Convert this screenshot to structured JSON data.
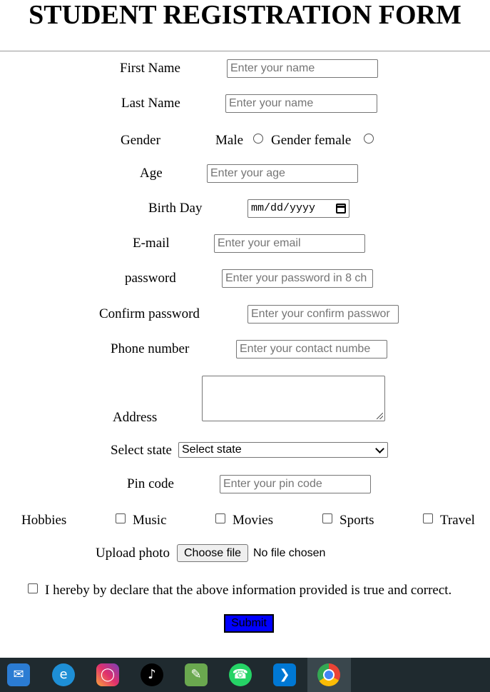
{
  "form": {
    "title": "STUDENT REGISTRATION FORM",
    "first_name": {
      "label": "First Name",
      "placeholder": "Enter your name"
    },
    "last_name": {
      "label": "Last Name",
      "placeholder": "Enter your name"
    },
    "gender": {
      "label": "Gender",
      "male_label": "Male",
      "female_label": "Gender female"
    },
    "age": {
      "label": "Age",
      "placeholder": "Enter your age"
    },
    "birth_day": {
      "label": "Birth Day",
      "placeholder": "mm/dd/yyyy"
    },
    "email": {
      "label": "E-mail",
      "placeholder": "Enter your email"
    },
    "password": {
      "label": "password",
      "placeholder": "Enter your password in 8 ch"
    },
    "confirm_password": {
      "label": "Confirm password",
      "placeholder": "Enter your confirm passwor"
    },
    "phone": {
      "label": "Phone number",
      "placeholder": "Enter your contact numbe"
    },
    "address": {
      "label": "Address"
    },
    "state": {
      "label": "Select state",
      "selected": "Select state"
    },
    "pin_code": {
      "label": "Pin code",
      "placeholder": "Enter your pin code"
    },
    "hobbies": {
      "label": "Hobbies",
      "options": [
        "Music",
        "Movies",
        "Sports",
        "Travel"
      ]
    },
    "upload": {
      "label": "Upload photo",
      "button": "Choose file",
      "status": "No file chosen"
    },
    "declaration": "I hereby by declare that the above information provided is true and correct.",
    "submit": "Submit"
  },
  "taskbar": {
    "icons": [
      "mail-icon",
      "edge-icon",
      "instagram-icon",
      "tiktok-icon",
      "notepad-icon",
      "whatsapp-icon",
      "vscode-icon",
      "chrome-icon"
    ],
    "colors": {
      "background": "#1f2a2f",
      "active": "#3a474d"
    }
  }
}
